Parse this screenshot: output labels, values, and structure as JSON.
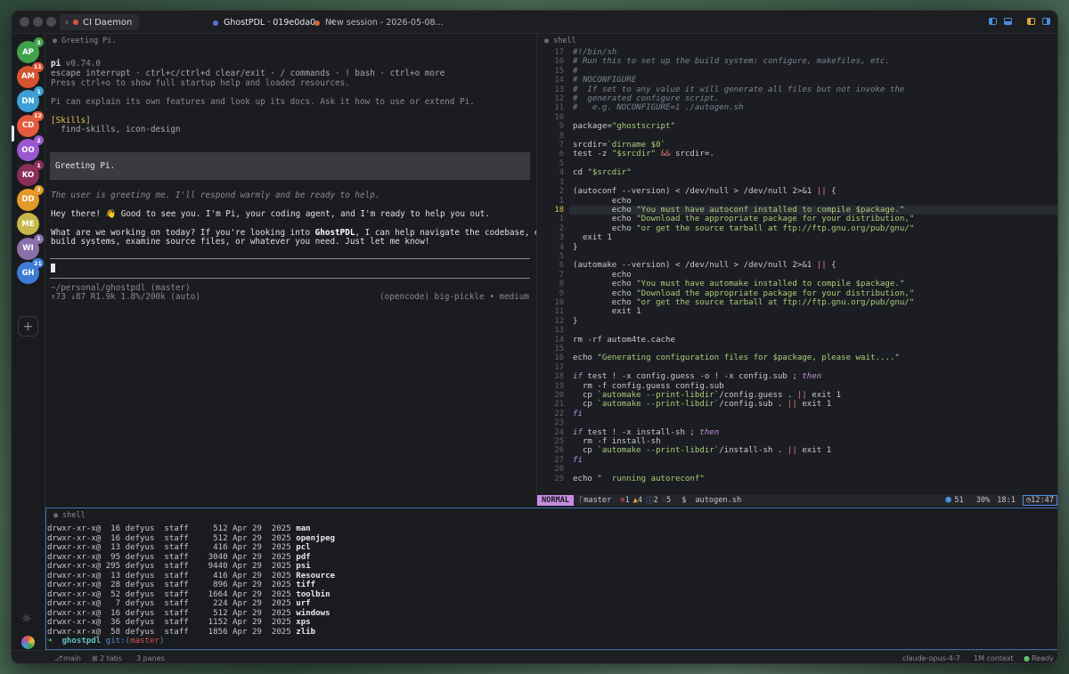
{
  "window": {
    "workspace_label": "CI Daemon",
    "workspace_chevron": "›",
    "tabs": [
      {
        "label": "GhostPDL · 019e0da0",
        "close": "✕",
        "dot_color": "#5b6ee1"
      },
      {
        "label": "New session - 2026-05-08...",
        "dot_color": "#d0663a"
      }
    ]
  },
  "sidebar": {
    "avatars": [
      {
        "initials": "AP",
        "color": "#3fa14a",
        "badge": "3",
        "badge_color": "#3fa14a"
      },
      {
        "initials": "AM",
        "color": "#d6532f",
        "badge": "11",
        "badge_color": "#d6532f"
      },
      {
        "initials": "DN",
        "color": "#3d9fd6",
        "badge": "1",
        "badge_color": "#3d9fd6"
      },
      {
        "initials": "CD",
        "color": "#e35a3d",
        "badge": "12",
        "badge_color": "#e35a3d"
      },
      {
        "initials": "OO",
        "color": "#9b59d0",
        "badge": "2",
        "badge_color": "#9b59d0"
      },
      {
        "initials": "KO",
        "color": "#8a2f5a",
        "badge": "1",
        "badge_color": "#8a2f5a"
      },
      {
        "initials": "DD",
        "color": "#e39a2a",
        "badge": "3",
        "badge_color": "#e39a2a"
      },
      {
        "initials": "ME",
        "color": "#c7b84a",
        "badge": "",
        "badge_color": ""
      },
      {
        "initials": "WI",
        "color": "#8a6fa8",
        "badge": "1",
        "badge_color": "#8a6fa8"
      },
      {
        "initials": "GH",
        "color": "#3d7bd6",
        "badge": "21",
        "badge_color": "#3d7bd6"
      }
    ],
    "add_label": "+",
    "settings_glyph": "☼"
  },
  "pi_pane": {
    "header": "Greeting Pi.",
    "version_name": "pi",
    "version": " v0.74.0",
    "help_line": "escape interrupt · ctrl+c/ctrl+d clear/exit · / commands · ! bash · ctrl+o more",
    "startup_line": "Press ctrl+o to show full startup help and loaded resources.",
    "explain_line": "Pi can explain its own features and look up its docs. Ask it how to use or extend Pi.",
    "skills_label": "[Skills]",
    "skills_list": "  find-skills, icon-design",
    "user_message": "Greeting Pi.",
    "thinking": "The user is greeting me. I'll respond warmly and be ready to help.",
    "reply1": "Hey there! 👋 Good to see you. I'm Pi, your coding agent, and I'm ready to help you out.",
    "reply2_a": "What are we working on today? If you're looking into ",
    "reply2_b": "GhostPDL",
    "reply2_c": ", I can help navigate the codebase, explore",
    "reply3": "build systems, examine source files, or whatever you need. Just let me know!",
    "cwd": "~/personal/ghostpdl (master)",
    "stats": "↑73 ↓87 R1.9k 1.8%/200k (auto)",
    "model": "(opencode) big-pickle • medium"
  },
  "editor": {
    "header": "shell",
    "line_numbers": [
      "17",
      "16",
      "15",
      "14",
      "13",
      "12",
      "11",
      "10",
      "9",
      "8",
      "7",
      "6",
      "5",
      "4",
      "3",
      "2",
      "1",
      "18",
      "1",
      "2",
      "3",
      "4",
      "5",
      "6",
      "7",
      "8",
      "9",
      "10",
      "11",
      "12",
      "13",
      "14",
      "15",
      "16",
      "17",
      "18",
      "19",
      "20",
      "21",
      "22",
      "23",
      "24",
      "25",
      "26",
      "27",
      "28",
      "29"
    ],
    "lines": [
      {
        "t": "#!/bin/sh",
        "c": "cmt"
      },
      {
        "t": "# Run this to set up the build system: configure, makefiles, etc.",
        "c": "cmt"
      },
      {
        "t": "#",
        "c": "cmt"
      },
      {
        "t": "# NOCONFIGURE",
        "c": "cmt"
      },
      {
        "t": "#  If set to any value it will generate all files but not invoke the",
        "c": "cmt"
      },
      {
        "t": "#  generated configure script.",
        "c": "cmt"
      },
      {
        "t": "#   e.g. NOCONFIGURE=1 ./autogen.sh",
        "c": "cmt"
      },
      {
        "t": "",
        "c": ""
      },
      {
        "t": "package=\"ghostscript\"",
        "c": "pkg"
      },
      {
        "t": "",
        "c": ""
      },
      {
        "t": "srcdir=`dirname $0`",
        "c": "srcdir"
      },
      {
        "t": "test -z \"$srcdir\" && srcdir=.",
        "c": "test"
      },
      {
        "t": "",
        "c": ""
      },
      {
        "t": "cd \"$srcdir\"",
        "c": "cd"
      },
      {
        "t": "",
        "c": ""
      },
      {
        "t": "(autoconf --version) < /dev/null > /dev/null 2>&1 || {",
        "c": "plain"
      },
      {
        "t": "        echo",
        "c": "plain"
      },
      {
        "t": "        echo \"You must have autoconf installed to compile $package.\"",
        "c": "echo"
      },
      {
        "t": "        echo \"Download the appropriate package for your distribution,\"",
        "c": "echo"
      },
      {
        "t": "        echo \"or get the source tarball at ftp://ftp.gnu.org/pub/gnu/\"",
        "c": "echo"
      },
      {
        "t": "  exit 1",
        "c": "plain"
      },
      {
        "t": "}",
        "c": "plain"
      },
      {
        "t": "",
        "c": ""
      },
      {
        "t": "(automake --version) < /dev/null > /dev/null 2>&1 || {",
        "c": "plain"
      },
      {
        "t": "        echo",
        "c": "plain"
      },
      {
        "t": "        echo \"You must have automake installed to compile $package.\"",
        "c": "echo"
      },
      {
        "t": "        echo \"Download the appropriate package for your distribution,\"",
        "c": "echo"
      },
      {
        "t": "        echo \"or get the source tarball at ftp://ftp.gnu.org/pub/gnu/\"",
        "c": "echo"
      },
      {
        "t": "        exit 1",
        "c": "plain"
      },
      {
        "t": "}",
        "c": "plain"
      },
      {
        "t": "",
        "c": ""
      },
      {
        "t": "rm -rf autom4te.cache",
        "c": "plain"
      },
      {
        "t": "",
        "c": ""
      },
      {
        "t": "echo \"Generating configuration files for $package, please wait....\"",
        "c": "echo"
      },
      {
        "t": "",
        "c": ""
      },
      {
        "t": "if test ! -x config.guess -o ! -x config.sub ; then",
        "c": "if"
      },
      {
        "t": "  rm -f config.guess config.sub",
        "c": "plain"
      },
      {
        "t": "  cp `automake --print-libdir`/config.guess . || exit 1",
        "c": "plain"
      },
      {
        "t": "  cp `automake --print-libdir`/config.sub . || exit 1",
        "c": "plain"
      },
      {
        "t": "fi",
        "c": "kw"
      },
      {
        "t": "",
        "c": ""
      },
      {
        "t": "if test ! -x install-sh ; then",
        "c": "if"
      },
      {
        "t": "  rm -f install-sh",
        "c": "plain"
      },
      {
        "t": "  cp `automake --print-libdir`/install-sh . || exit 1",
        "c": "plain"
      },
      {
        "t": "fi",
        "c": "kw"
      },
      {
        "t": "",
        "c": ""
      },
      {
        "t": "echo \"  running autoreconf\"",
        "c": "echo"
      }
    ],
    "current_line_index": 17,
    "status": {
      "mode": "NORMAL",
      "branch": " master",
      "errors": "1",
      "warnings": "4",
      "info": "2",
      "hints": "5",
      "prompt": "$",
      "file": "autogen.sh",
      "lsp": "51",
      "percent": "30%",
      "position": "18:1",
      "clock": "12:47"
    }
  },
  "shell": {
    "header": "shell",
    "rows": [
      {
        "perm": "drwxr-xr-x@",
        "links": " 16",
        "user": "defyus",
        "group": "staff",
        "size": "  512",
        "date": "Apr 29  2025",
        "name": "man"
      },
      {
        "perm": "drwxr-xr-x@",
        "links": " 16",
        "user": "defyus",
        "group": "staff",
        "size": "  512",
        "date": "Apr 29  2025",
        "name": "openjpeg"
      },
      {
        "perm": "drwxr-xr-x@",
        "links": " 13",
        "user": "defyus",
        "group": "staff",
        "size": "  416",
        "date": "Apr 29  2025",
        "name": "pcl"
      },
      {
        "perm": "drwxr-xr-x@",
        "links": " 95",
        "user": "defyus",
        "group": "staff",
        "size": " 3040",
        "date": "Apr 29  2025",
        "name": "pdf"
      },
      {
        "perm": "drwxr-xr-x@",
        "links": "295",
        "user": "defyus",
        "group": "staff",
        "size": " 9440",
        "date": "Apr 29  2025",
        "name": "psi"
      },
      {
        "perm": "drwxr-xr-x@",
        "links": " 13",
        "user": "defyus",
        "group": "staff",
        "size": "  416",
        "date": "Apr 29  2025",
        "name": "Resource"
      },
      {
        "perm": "drwxr-xr-x@",
        "links": " 28",
        "user": "defyus",
        "group": "staff",
        "size": "  896",
        "date": "Apr 29  2025",
        "name": "tiff"
      },
      {
        "perm": "drwxr-xr-x@",
        "links": " 52",
        "user": "defyus",
        "group": "staff",
        "size": " 1664",
        "date": "Apr 29  2025",
        "name": "toolbin"
      },
      {
        "perm": "drwxr-xr-x@",
        "links": "  7",
        "user": "defyus",
        "group": "staff",
        "size": "  224",
        "date": "Apr 29  2025",
        "name": "urf"
      },
      {
        "perm": "drwxr-xr-x@",
        "links": " 16",
        "user": "defyus",
        "group": "staff",
        "size": "  512",
        "date": "Apr 29  2025",
        "name": "windows"
      },
      {
        "perm": "drwxr-xr-x@",
        "links": " 36",
        "user": "defyus",
        "group": "staff",
        "size": " 1152",
        "date": "Apr 29  2025",
        "name": "xps"
      },
      {
        "perm": "drwxr-xr-x@",
        "links": " 58",
        "user": "defyus",
        "group": "staff",
        "size": " 1856",
        "date": "Apr 29  2025",
        "name": "zlib"
      }
    ],
    "prompt_arrow": "➜",
    "prompt_dir": "ghostpdl",
    "prompt_git": "git:(",
    "prompt_branch": "master",
    "prompt_close": ")"
  },
  "bottombar": {
    "branch": "main",
    "tabs": "2 tabs",
    "panes": "3 panes",
    "model": "claude-opus-4-7",
    "context": "1M context",
    "status": "Ready"
  }
}
